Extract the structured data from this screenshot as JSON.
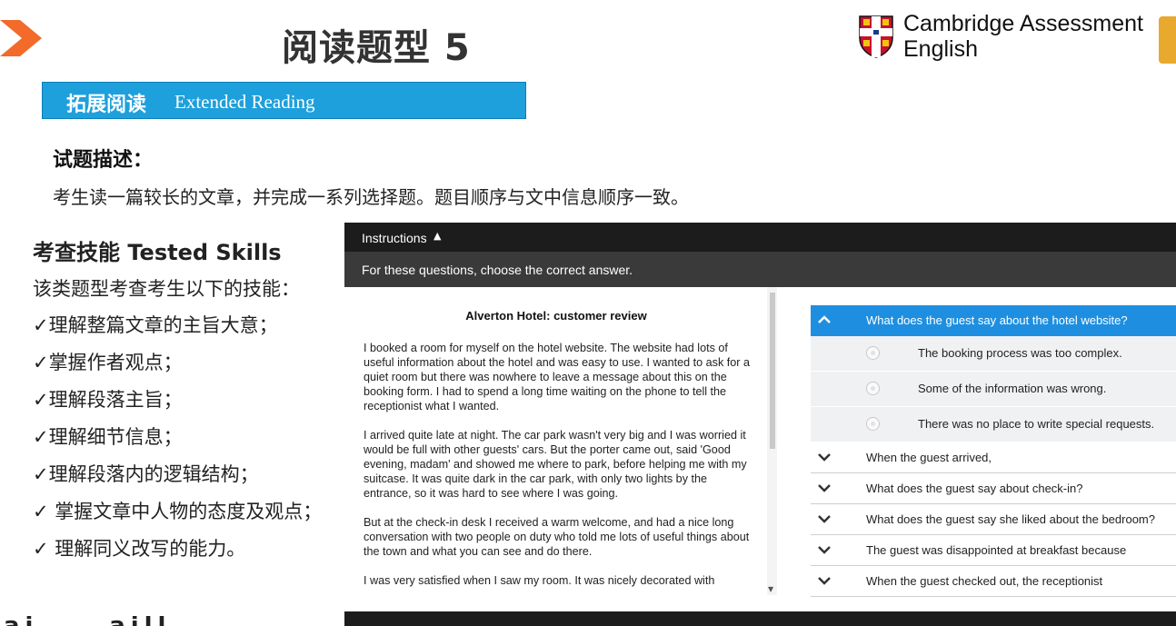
{
  "slide": {
    "title": "阅读题型 5",
    "logo_line1": "Cambridge Assessment",
    "logo_line2": "English",
    "section_zh": "拓展阅读",
    "section_en": "Extended Reading",
    "desc_heading": "试题描述：",
    "desc_text": "考生读一篇较长的文章，并完成一系列选择题。题目顺序与文中信息顺序一致。",
    "skills_heading": "考查技能 Tested Skills",
    "skills_intro": "该类题型考查考生以下的技能：",
    "skills": [
      "✓理解整篇文章的主旨大意；",
      "✓掌握作者观点；",
      "✓理解段落主旨；",
      "✓理解细节信息；",
      "✓理解段落内的逻辑结构；",
      "✓ 掌握文章中人物的态度及观点；",
      "✓ 理解同义改写的能力。"
    ],
    "bottom_fragment": "ai ... aill"
  },
  "exam": {
    "instructions_label": "Instructions",
    "instructions_text": "For these questions, choose the correct answer.",
    "passage_title": "Alverton Hotel: customer review",
    "paragraphs": [
      "I booked a room for myself on the hotel website. The website had lots of useful information about the hotel and was easy to use.  I wanted to ask for a quiet room but there was nowhere to leave a message about this on the booking form.  I had to spend a long time waiting on the phone to tell the receptionist what I wanted.",
      "I arrived quite late at night.  The car park wasn't very big and I was worried it would be full with other guests' cars.  But the porter came out, said 'Good evening, madam' and showed me where to park, before helping me with my suitcase.  It was quite dark in the car park, with only two lights by the entrance, so it was hard to see where I was going.",
      "But at the check-in desk I received a warm welcome, and had a nice long conversation with two people on duty who told me lots of useful things about the town and what you can see and do there.",
      "I was very satisfied when I saw my room.  It was nicely decorated with"
    ],
    "open_question": "What does the guest say about the hotel website?",
    "options": [
      "The booking process was too complex.",
      "Some of the information was wrong.",
      "There was no place to write special requests."
    ],
    "questions": [
      "When the guest arrived,",
      "What does the guest say about check-in?",
      "What does the guest say she liked about the bedroom?",
      "The guest was disappointed at breakfast because",
      "When the guest checked out, the receptionist"
    ]
  },
  "colors": {
    "accent": "#1e8fe0",
    "bar": "#1ea0dc",
    "arrow": "#f26b2a"
  }
}
